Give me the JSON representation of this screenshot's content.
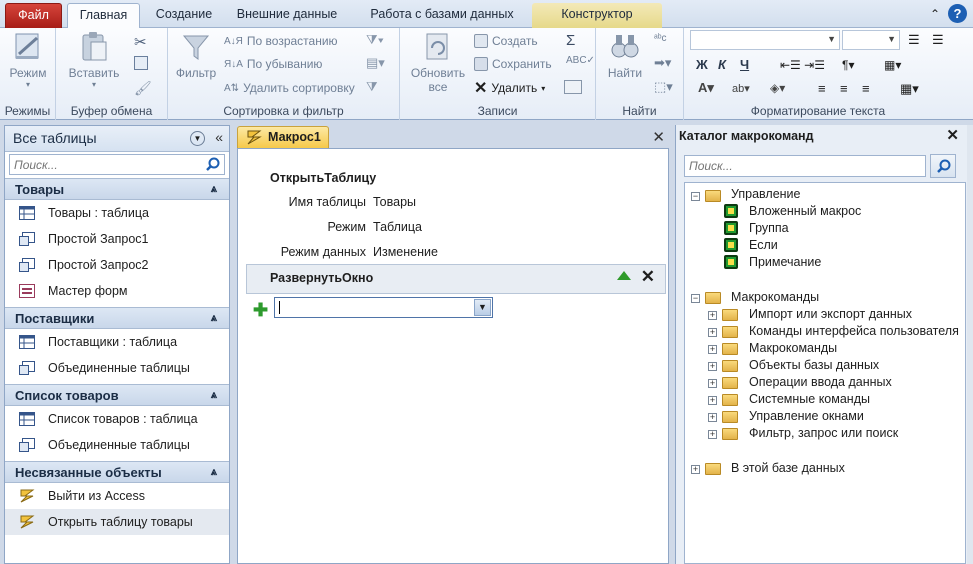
{
  "tabs": {
    "file": "Файл",
    "home": "Главная",
    "create": "Создание",
    "external": "Внешние данные",
    "dbtools": "Работа с базами данных",
    "designer": "Конструктор"
  },
  "ribbon": {
    "views": {
      "mode": "Режим",
      "label": "Режимы"
    },
    "clipboard": {
      "paste": "Вставить",
      "label": "Буфер обмена"
    },
    "sort": {
      "filter": "Фильтр",
      "asc": "По возрастанию",
      "desc": "По убыванию",
      "remove": "Удалить сортировку",
      "label": "Сортировка и фильтр"
    },
    "records": {
      "refresh": "Обновить",
      "refresh2": "все",
      "create": "Создать",
      "save": "Сохранить",
      "delete": "Удалить",
      "label": "Записи"
    },
    "find": {
      "find": "Найти",
      "label": "Найти"
    },
    "text": {
      "label": "Форматирование текста"
    }
  },
  "nav": {
    "title": "Все таблицы",
    "search_placeholder": "Поиск...",
    "groups": [
      {
        "name": "Товары",
        "items": [
          "Товары : таблица",
          "Простой Запрос1",
          "Простой Запрос2",
          "Мастер форм"
        ]
      },
      {
        "name": "Поставщики",
        "items": [
          "Поставщики : таблица",
          "Объединенные таблицы"
        ]
      },
      {
        "name": "Список товаров",
        "items": [
          "Список товаров : таблица",
          "Объединенные таблицы"
        ]
      },
      {
        "name": "Несвязанные объекты",
        "items": [
          "Выйти из Access",
          "Открыть таблицу товары"
        ]
      }
    ]
  },
  "macro": {
    "tab": "Макрос1",
    "action1": {
      "name": "ОткрытьТаблицу",
      "args": [
        {
          "key": "Имя таблицы",
          "value": "Товары"
        },
        {
          "key": "Режим",
          "value": "Таблица"
        },
        {
          "key": "Режим данных",
          "value": "Изменение"
        }
      ]
    },
    "action2": {
      "name": "РазвернутьОкно"
    },
    "new_action_value": ""
  },
  "catalog": {
    "title": "Каталог макрокоманд",
    "search_placeholder": "Поиск...",
    "control": {
      "name": "Управление",
      "items": [
        "Вложенный макрос",
        "Группа",
        "Если",
        "Примечание"
      ]
    },
    "actions": {
      "name": "Макрокоманды",
      "items": [
        "Импорт или экспорт данных",
        "Команды интерфейса пользователя",
        "Макрокоманды",
        "Объекты базы данных",
        "Операции ввода данных",
        "Системные команды",
        "Управление окнами",
        "Фильтр, запрос или поиск"
      ]
    },
    "in_db": "В этой базе данных"
  },
  "colors": {
    "file_tab": "#c42b23",
    "designer_tab": "#efe2a0",
    "macro_tab": "#f6c94a",
    "accent": "#1d5fb3"
  }
}
